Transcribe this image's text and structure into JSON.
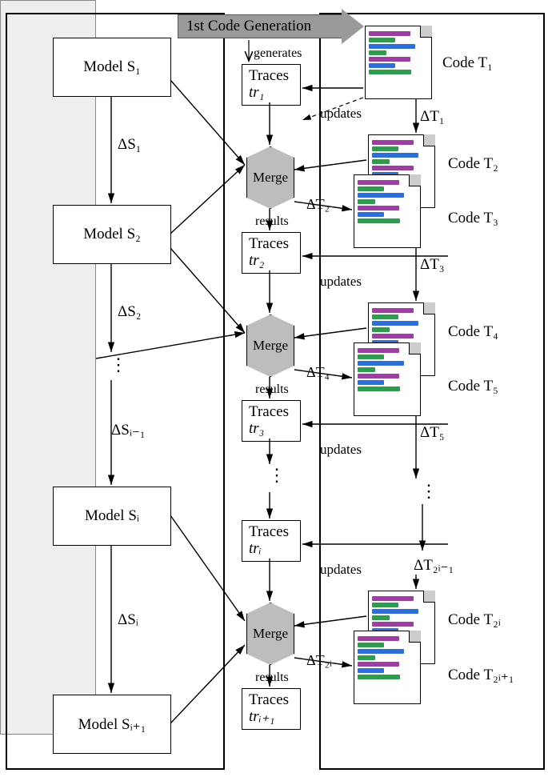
{
  "banner": {
    "label": "1st Code Generation"
  },
  "actions": {
    "generates": "generates",
    "updates": "updates",
    "results": "results",
    "merge": "Merge"
  },
  "models": {
    "s1": "Model S₁",
    "s2": "Model S₂",
    "si": "Model Sᵢ",
    "sip1": "Model Sᵢ₊₁"
  },
  "deltasS": {
    "d1": "ΔS₁",
    "d2": "ΔS₂",
    "dim1": "ΔSᵢ₋₁",
    "di": "ΔSᵢ"
  },
  "traces": {
    "tr1_line1": "Traces",
    "tr1_line2": "tr₁",
    "tr2_line1": "Traces",
    "tr2_line2": "tr₂",
    "tr3_line1": "Traces",
    "tr3_line2": "tr₃",
    "tri_line1": "Traces",
    "tri_line2": "trᵢ",
    "trip1_line1": "Traces",
    "trip1_line2": "trᵢ₊₁"
  },
  "codes": {
    "t1": "Code T₁",
    "t2": "Code T₂",
    "t3": "Code T₃",
    "t4": "Code T₄",
    "t5": "Code T₅",
    "t2i": "Code T₂ᵢ",
    "t2ip1": "Code T₂ᵢ₊₁"
  },
  "deltasT": {
    "d1": "ΔT₁",
    "d2": "ΔT₂",
    "d3": "ΔT₃",
    "d4": "ΔT₄",
    "d5": "ΔT₅",
    "d2im1": "ΔT₂ᵢ₋₁",
    "d2i": "ΔT₂ᵢ"
  }
}
